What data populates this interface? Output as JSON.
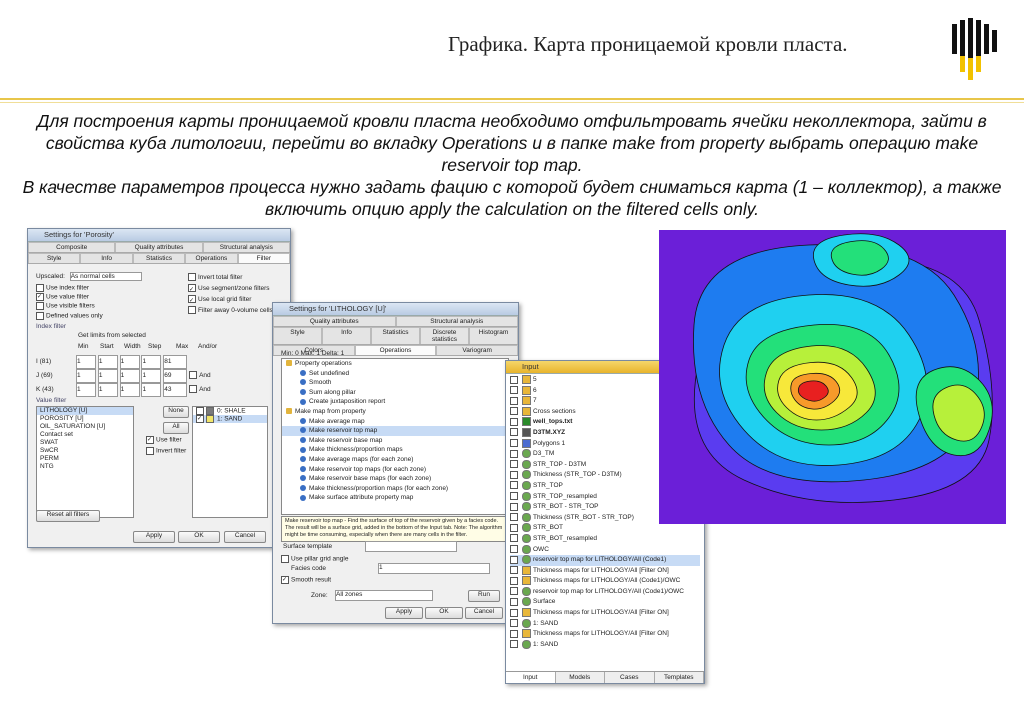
{
  "slide": {
    "title": "Графика. Карта проницаемой кровли пласта.",
    "paragraph1": "Для построения карты проницаемой кровли пласта необходимо отфильтровать ячейки неколлектора, зайти в свойства куба литологии, перейти во вкладку Operations и в папке make from property выбрать операцию make reservoir top map.",
    "paragraph2": "В качестве параметров процесса нужно задать фацию с которой будет сниматься карта (1 – коллектор), а также включить опцию apply the calculation on the filtered cells only.",
    "colors": {
      "accent_line": "#e8c64a",
      "logo_yellow": "#f2c200",
      "logo_black": "#111111"
    }
  },
  "win1": {
    "title": "Settings for 'Porosity'",
    "tabs_top": [
      "Composite",
      "Quality attributes",
      "Structural analysis"
    ],
    "tabs_bottom": [
      "Style",
      "Info",
      "Statistics",
      "Operations",
      "Filter"
    ],
    "upscaled_label": "Upscaled:",
    "upscaled_value": "As normal cells",
    "checks_left": [
      "Use index filter",
      "Use value filter",
      "Use visible filters",
      "Defined values only"
    ],
    "checks_right": [
      "Invert total filter",
      "Use segment/zone filters",
      "Use local grid filter",
      "Filter away 0-volume cells"
    ],
    "index_filter_label": "Index filter",
    "get_limits": "Get limits from selected",
    "col_headers": [
      "Min",
      "Start",
      "Width",
      "Step",
      "Max",
      "And/or"
    ],
    "index_rows": [
      {
        "label": "I (81)",
        "min": "1",
        "start": "1",
        "width": "1",
        "step": "1",
        "max": "81"
      },
      {
        "label": "J (69)",
        "min": "1",
        "start": "1",
        "width": "1",
        "step": "1",
        "max": "69"
      },
      {
        "label": "K (43)",
        "min": "1",
        "start": "1",
        "width": "1",
        "step": "1",
        "max": "43"
      }
    ],
    "and_labels": [
      "And",
      "And"
    ],
    "value_filter_label": "Value filter",
    "value_list": [
      "LITHOLOGY [U]",
      "POROSITY [U]",
      "OIL_SATURATION [U]",
      "Contact set",
      "SWAT",
      "SwCR",
      "PERM",
      "NTG"
    ],
    "none_btn": "None",
    "all_btn": "All",
    "use_filter": "Use filter",
    "invert_filter": "Invert filter",
    "facies": [
      {
        "label": "0: SHALE",
        "color": "#7a7a7a"
      },
      {
        "label": "1: SAND",
        "color": "#f2e66a"
      }
    ],
    "reset_filters": "Reset all filters",
    "apply": "Apply",
    "ok": "OK",
    "cancel": "Cancel"
  },
  "win2": {
    "title": "Settings for 'LITHOLOGY [U]'",
    "tabs_top": [
      "Quality attributes",
      "Structural analysis"
    ],
    "tabs_mid": [
      "Style",
      "Info",
      "Statistics",
      "Discrete statistics",
      "Histogram"
    ],
    "tabs_bot": [
      "Colors",
      "Operations",
      "Variogram"
    ],
    "minmax": "Min: 0   Max: 1   Delta: 1",
    "tree": [
      {
        "label": "Property operations",
        "indent": 0
      },
      {
        "label": "Set undefined",
        "indent": 1
      },
      {
        "label": "Smooth",
        "indent": 1
      },
      {
        "label": "Sum along pillar",
        "indent": 1
      },
      {
        "label": "Create juxtaposition report",
        "indent": 1
      },
      {
        "label": "Make map from property",
        "indent": 0
      },
      {
        "label": "Make average map",
        "indent": 1
      },
      {
        "label": "Make reservoir top map",
        "indent": 1,
        "selected": true
      },
      {
        "label": "Make reservoir base map",
        "indent": 1
      },
      {
        "label": "Make thickness/proportion maps",
        "indent": 1
      },
      {
        "label": "Make average maps (for each zone)",
        "indent": 1
      },
      {
        "label": "Make reservoir top maps (for each zone)",
        "indent": 1
      },
      {
        "label": "Make reservoir base maps (for each zone)",
        "indent": 1
      },
      {
        "label": "Make thickness/proportion maps (for each zone)",
        "indent": 1
      },
      {
        "label": "Make surface attribute property map",
        "indent": 1
      }
    ],
    "description": "Make reservoir top map - Find the surface of top of the reservoir given by a facies code. The result will be a surface grid, added in the bottom of the Input tab. Note: The algorithm might be time consuming, especially when there are many cells in the filter.",
    "surface_template": "Surface template",
    "use_pillar": "Use pillar grid angle",
    "facies_code": "Facies code",
    "facies_value": "1",
    "smooth_result": "Smooth result",
    "zone_label": "Zone:",
    "zone_value": "All zones",
    "run": "Run",
    "apply": "Apply",
    "ok": "OK",
    "cancel": "Cancel"
  },
  "win3": {
    "title": "Input",
    "tree": [
      {
        "label": "5",
        "icon": "folder"
      },
      {
        "label": "6",
        "icon": "folder"
      },
      {
        "label": "7",
        "icon": "folder"
      },
      {
        "label": "Cross sections",
        "icon": "folder"
      },
      {
        "label": "well_tops.txt",
        "icon": "tops",
        "bold": true
      },
      {
        "label": "D3TM.XYZ",
        "icon": "points",
        "bold": true
      },
      {
        "label": "Polygons 1",
        "icon": "polygon"
      },
      {
        "label": "D3_TM",
        "icon": "surface"
      },
      {
        "label": "STR_TOP - D3TM",
        "icon": "surface"
      },
      {
        "label": "Thickness (STR_TOP - D3TM)",
        "icon": "surface"
      },
      {
        "label": "STR_TOP",
        "icon": "surface"
      },
      {
        "label": "STR_TOP_resampled",
        "icon": "surface"
      },
      {
        "label": "STR_BOT - STR_TOP",
        "icon": "surface"
      },
      {
        "label": "Thickness (STR_BOT - STR_TOP)",
        "icon": "surface"
      },
      {
        "label": "STR_BOT",
        "icon": "surface"
      },
      {
        "label": "STR_BOT_resampled",
        "icon": "surface"
      },
      {
        "label": "OWC",
        "icon": "surface"
      },
      {
        "label": "reservoir top map for LITHOLOGY/All (Code1)",
        "icon": "surface",
        "selected": true
      },
      {
        "label": "Thickness maps for LITHOLOGY/All [Filter ON]",
        "icon": "folder"
      },
      {
        "label": "Thickness maps for LITHOLOGY/All (Code1)/OWC",
        "icon": "folder"
      },
      {
        "label": "reservoir top map for LITHOLOGY/All (Code1)/OWC",
        "icon": "surface"
      },
      {
        "label": "Surface",
        "icon": "surface"
      },
      {
        "label": "Thickness maps for LITHOLOGY/All [Filter ON]",
        "icon": "folder"
      },
      {
        "label": "1: SAND",
        "icon": "surface"
      },
      {
        "label": "Thickness maps for LITHOLOGY/All [Filter ON]",
        "icon": "folder"
      },
      {
        "label": "1: SAND",
        "icon": "surface"
      }
    ],
    "bottom_tabs": [
      "Input",
      "Models",
      "Cases",
      "Templates"
    ]
  }
}
